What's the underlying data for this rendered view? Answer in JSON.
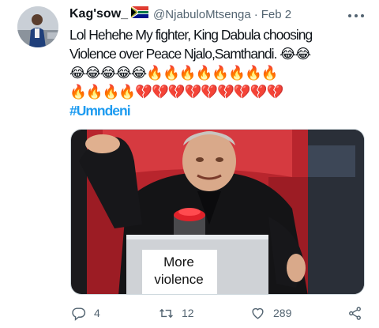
{
  "tweet": {
    "author_name": "Kag'sow_",
    "author_flag": "south-africa-flag-emoji",
    "handle": "@NjabuloMtsenga",
    "separator": "·",
    "date": "Feb 2",
    "text_line1": "Lol Hehehe My fighter, King Dabula  choosing",
    "text_line2": "Violence over Peace Njalo,Samthandi. 😂😂",
    "emoji_line3": "😂😂😂😂😂🔥🔥🔥🔥🔥🔥🔥🔥",
    "emoji_line4": "🔥🔥🔥🔥💔💔💔💔💔💔💔💔💔",
    "hashtag": "#Umndeni",
    "media": {
      "alt_icon": "meme-image",
      "caption_line1": "More",
      "caption_line2": "violence"
    },
    "actions": {
      "reply_count": "4",
      "retweet_count": "12",
      "like_count": "289"
    }
  },
  "colors": {
    "link": "#1d9bf0",
    "secondary_text": "#536471",
    "primary_text": "#0f1419",
    "chair_red": "#c62c33"
  }
}
